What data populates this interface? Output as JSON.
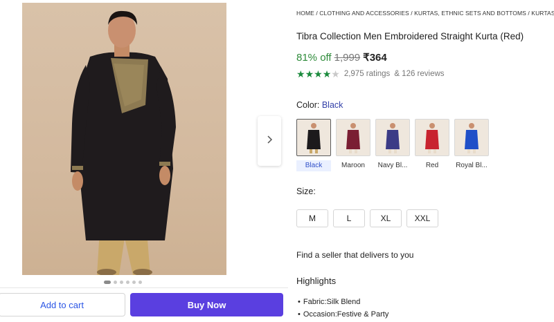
{
  "breadcrumb": "HOME / CLOTHING AND ACCESSORIES / KURTAS, ETHNIC SETS AND BOTTOMS / KURTAS / MEN",
  "product": {
    "title": "Tibra Collection Men Embroidered Straight Kurta (Red)",
    "discount": "81% off",
    "mrp": "1,999",
    "price": "₹364",
    "rating_stars": 4,
    "rating_max": 5,
    "ratings_text": "2,975 ratings",
    "reviews_text": "& 126 reviews"
  },
  "color": {
    "label": "Color:",
    "selected": "Black",
    "options": [
      {
        "label": "Black",
        "hex": "#1c1a1c"
      },
      {
        "label": "Maroon",
        "hex": "#7a1e33"
      },
      {
        "label": "Navy Bl...",
        "hex": "#3b3b86"
      },
      {
        "label": "Red",
        "hex": "#c8232f"
      },
      {
        "label": "Royal Bl...",
        "hex": "#1f4fc8"
      }
    ]
  },
  "size": {
    "label": "Size:",
    "options": [
      "M",
      "L",
      "XL",
      "XXL"
    ]
  },
  "seller_text": "Find a seller that delivers to you",
  "highlights": {
    "title": "Highlights",
    "items": [
      "Fabric:Silk Blend",
      "Occasion:Festive & Party"
    ]
  },
  "actions": {
    "add_to_cart": "Add to cart",
    "buy_now": "Buy Now"
  },
  "gallery": {
    "dot_count": 6,
    "active_dot": 0
  },
  "icons": {
    "next": "chevron-right-icon",
    "star": "star-icon"
  },
  "colors": {
    "accent": "#5a3fe0",
    "discount": "#2e8b3a",
    "link": "#2a55e5"
  }
}
